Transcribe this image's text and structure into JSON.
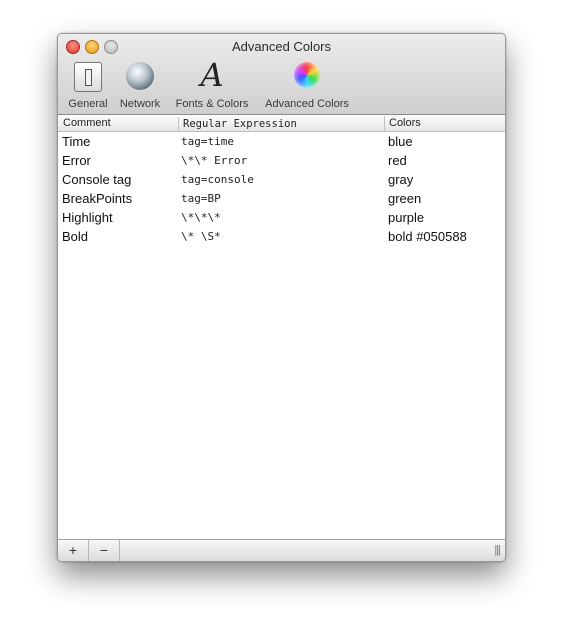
{
  "window": {
    "title": "Advanced Colors"
  },
  "toolbar": {
    "items": [
      {
        "label": "General",
        "icon": "general-icon"
      },
      {
        "label": "Network",
        "icon": "network-icon"
      },
      {
        "label": "Fonts & Colors",
        "icon": "fonts-icon",
        "glyph": "A"
      },
      {
        "label": "Advanced Colors",
        "icon": "color-wheel-icon"
      }
    ]
  },
  "table": {
    "columns": [
      "Comment",
      "Regular Expression",
      "Colors"
    ],
    "rows": [
      {
        "comment": "Time",
        "regex": "tag=time",
        "color": "blue"
      },
      {
        "comment": "Error",
        "regex": "\\*\\* Error",
        "color": "red"
      },
      {
        "comment": "Console tag",
        "regex": "tag=console",
        "color": "gray"
      },
      {
        "comment": "BreakPoints",
        "regex": "tag=BP",
        "color": "green"
      },
      {
        "comment": "Highlight",
        "regex": "\\*\\*\\*",
        "color": "purple"
      },
      {
        "comment": "Bold",
        "regex": "\\* \\S*",
        "color": "bold #050588"
      }
    ]
  },
  "bottom_bar": {
    "add_label": "+",
    "remove_label": "−",
    "grip": "|||"
  }
}
